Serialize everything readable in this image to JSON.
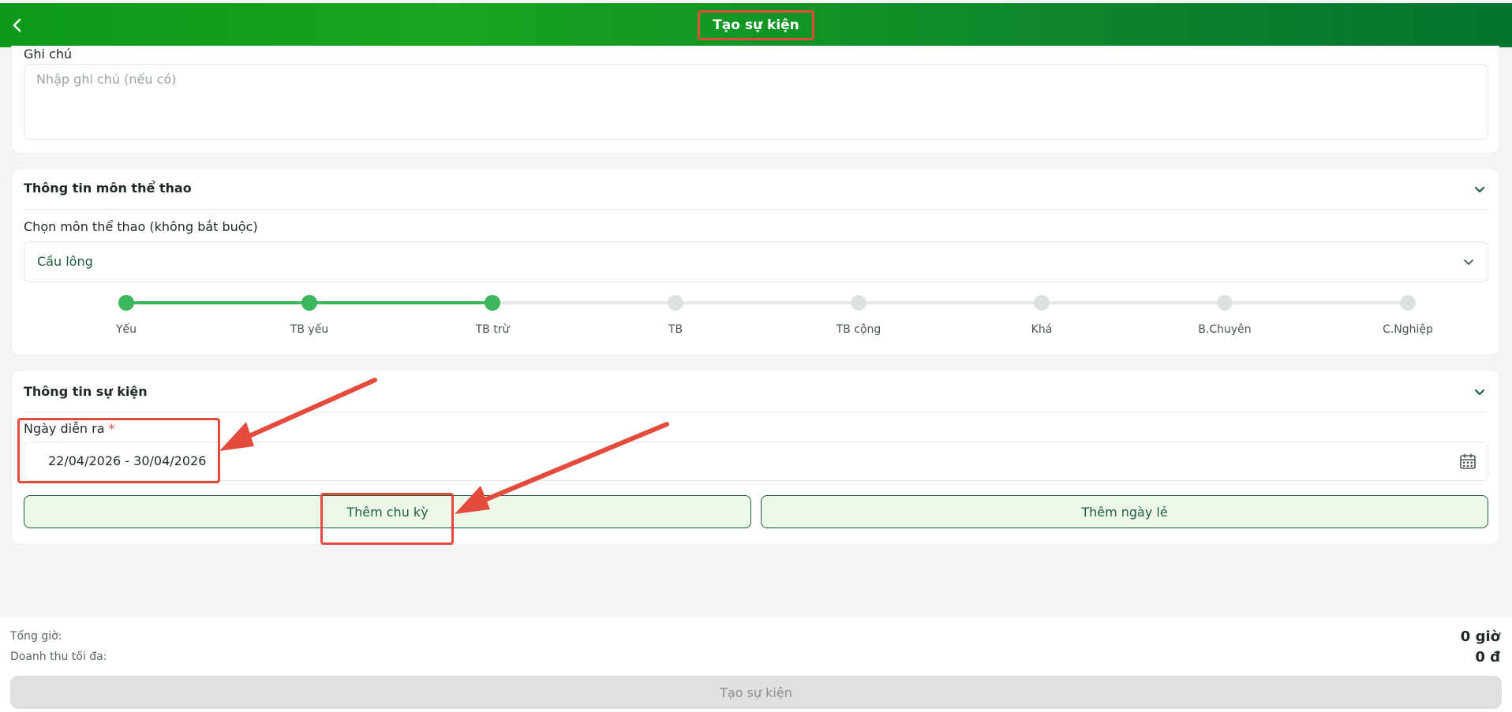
{
  "header": {
    "title": "Tạo sự kiện",
    "back_icon": "chevron-left-icon"
  },
  "note": {
    "label": "Ghi chú",
    "placeholder": "Nhập ghi chú (nếu có)"
  },
  "sports": {
    "section_title": "Thông tin môn thể thao",
    "select_label": "Chọn môn thể thao (không bắt buộc)",
    "selected_sport": "Cầu lông",
    "levels": [
      "Yếu",
      "TB yếu",
      "TB trừ",
      "TB",
      "TB cộng",
      "Khá",
      "B.Chuyên",
      "C.Nghiệp"
    ],
    "selected_level_index": 2,
    "accent_color": "#3cb55c"
  },
  "event": {
    "section_title": "Thông tin sự kiện",
    "date_label": "Ngày diễn ra",
    "required_mark": "*",
    "date_value": "22/04/2026 - 30/04/2026",
    "add_cycle_label": "Thêm chu kỳ",
    "add_holiday_label": "Thêm ngày lẻ"
  },
  "footer": {
    "total_hours_label": "Tổng giờ:",
    "total_hours_value": "0 giờ",
    "max_revenue_label": "Doanh thu tối đa:",
    "max_revenue_value": "0 đ",
    "submit_label": "Tạo sự kiện"
  },
  "colors": {
    "header_green": "#18a51f",
    "annotation_red": "#e54b3c",
    "button_green": "#1e5f3f"
  }
}
